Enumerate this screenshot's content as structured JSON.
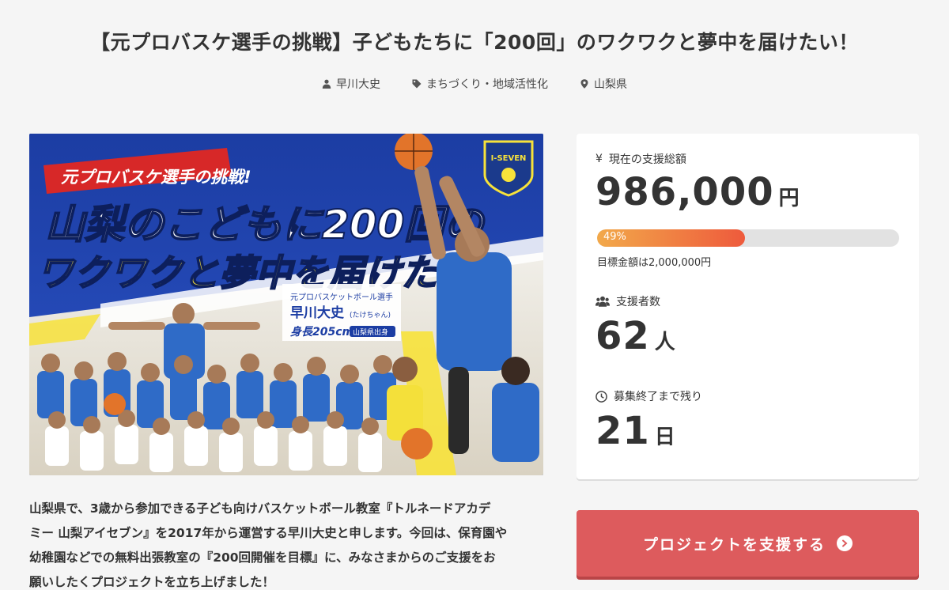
{
  "page": {
    "title": "【元プロバスケ選手の挑戦】子どもたちに「200回」のワクワクと夢中を届けたい！"
  },
  "meta": {
    "author": "早川大史",
    "category": "まちづくり・地域活性化",
    "location": "山梨県"
  },
  "hero": {
    "tagline": "元プロバスケ選手の挑戦!",
    "headline_1": "山梨のこどもに200回の",
    "headline_2": "ワクワクと夢中を届けたい!!",
    "caption_role": "元プロバスケットボール選手",
    "caption_name": "早川大史",
    "caption_nick": "(たけちゃん)",
    "caption_height": "身長205cm",
    "caption_origin": "山梨県出身",
    "logo_text": "I-SEVEN"
  },
  "stats": {
    "total_label": "現在の支援総額",
    "total_value": "986,000",
    "total_unit": "円",
    "progress_percent": 49,
    "progress_label": "49%",
    "goal_label": "目標金額は2,000,000円",
    "supporters_label": "支援者数",
    "supporters_value": "62",
    "supporters_unit": "人",
    "remaining_label": "募集終了まで残り",
    "remaining_value": "21",
    "remaining_unit": "日"
  },
  "cta": {
    "label": "プロジェクトを支援する"
  },
  "description": {
    "line_1": "山梨県で、3歳から参加できる子ども向けバスケットボール教室『トルネードアカデ",
    "line_2": "ミー 山梨アイセブン』を2017年から運営する早川大史と申します。今回は、保育園や",
    "line_3": "幼稚園などでの無料出張教室の『200回開催を目標』に、みなさまからのご支援をお",
    "line_4": "願いしたくプロジェクトを立ち上げました！"
  },
  "colors": {
    "accent": "#dd5b5d",
    "progress_start": "#f2a94a",
    "progress_end": "#ee5a3c",
    "hero_blue": "#1e3fa6",
    "hero_yellow": "#f7e23a"
  }
}
